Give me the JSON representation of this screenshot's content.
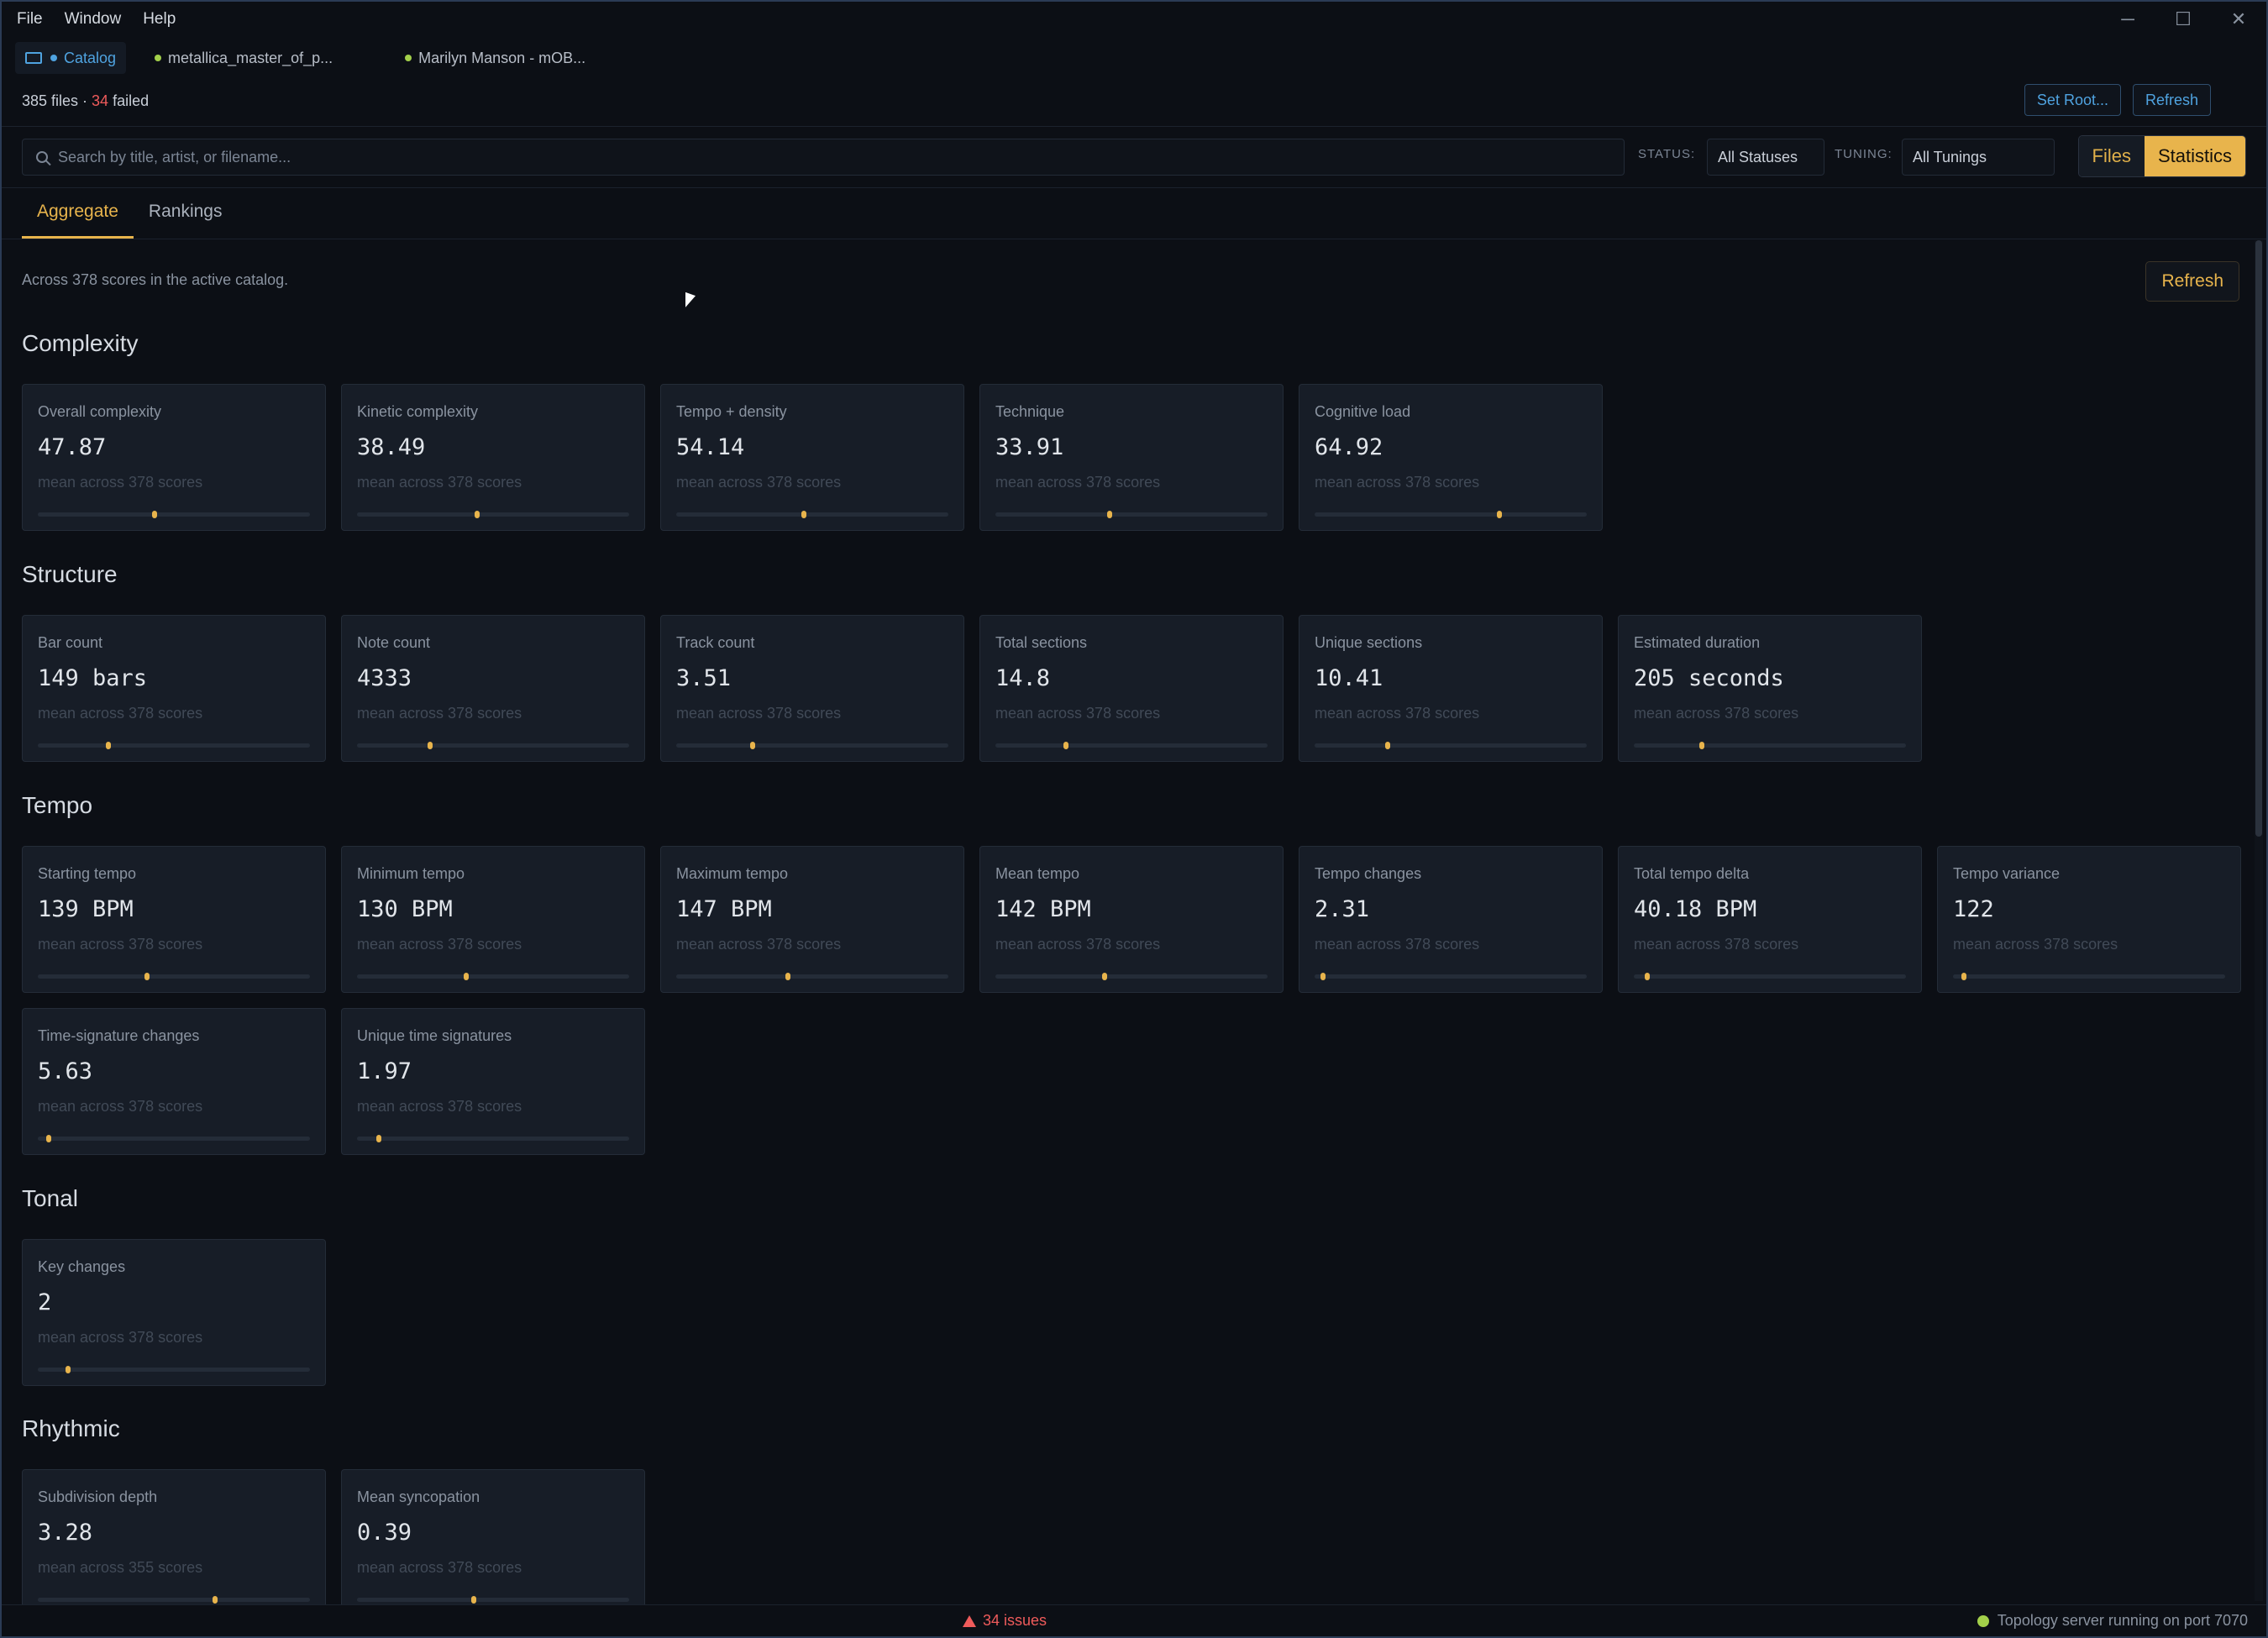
{
  "menu": [
    "File",
    "Window",
    "Help"
  ],
  "window_controls": {
    "minimize": "─",
    "maximize": "☐",
    "close": "✕"
  },
  "tabs": [
    {
      "label": "Catalog",
      "dot_color": "#4fa3e0"
    },
    {
      "label": "metallica_master_of_p...",
      "dot_color": "#a3d04a"
    },
    {
      "label": "Marilyn Manson - mOB...",
      "dot_color": "#a3d04a"
    }
  ],
  "counts": {
    "files": "385 files · ",
    "failed_n": "34",
    "failed_word": " failed"
  },
  "top_buttons": {
    "set_root": "Set Root...",
    "refresh": "Refresh"
  },
  "search": {
    "placeholder": "Search by title, artist, or filename..."
  },
  "filters": {
    "status_label": "STATUS:",
    "status_value": "All Statuses",
    "tuning_label": "TUNING:",
    "tuning_value": "All Tunings"
  },
  "view_toggle": {
    "files": "Files",
    "statistics": "Statistics",
    "active": "Statistics"
  },
  "subtabs": [
    {
      "label": "Aggregate",
      "active": true
    },
    {
      "label": "Rankings",
      "active": false
    }
  ],
  "summary": "Across 378 scores in the active catalog.",
  "refresh_label": "Refresh",
  "sections": [
    {
      "title": "Complexity",
      "cards": [
        {
          "label": "Overall complexity",
          "value": "47.87",
          "sub": "mean across 378 scores",
          "pos": 0.43
        },
        {
          "label": "Kinetic complexity",
          "value": "38.49",
          "sub": "mean across 378 scores",
          "pos": 0.44
        },
        {
          "label": "Tempo + density",
          "value": "54.14",
          "sub": "mean across 378 scores",
          "pos": 0.47
        },
        {
          "label": "Technique",
          "value": "33.91",
          "sub": "mean across 378 scores",
          "pos": 0.42
        },
        {
          "label": "Cognitive load",
          "value": "64.92",
          "sub": "mean across 378 scores",
          "pos": 0.68
        }
      ]
    },
    {
      "title": "Structure",
      "cards": [
        {
          "label": "Bar count",
          "value": "149 bars",
          "sub": "mean across 378 scores",
          "pos": 0.26
        },
        {
          "label": "Note count",
          "value": "4333",
          "sub": "mean across 378 scores",
          "pos": 0.27
        },
        {
          "label": "Track count",
          "value": "3.51",
          "sub": "mean across 378 scores",
          "pos": 0.28
        },
        {
          "label": "Total sections",
          "value": "14.8",
          "sub": "mean across 378 scores",
          "pos": 0.26
        },
        {
          "label": "Unique sections",
          "value": "10.41",
          "sub": "mean across 378 scores",
          "pos": 0.27
        },
        {
          "label": "Estimated duration",
          "value": "205 seconds",
          "sub": "mean across 378 scores",
          "pos": 0.25
        }
      ]
    },
    {
      "title": "Tempo",
      "cards": [
        {
          "label": "Starting tempo",
          "value": "139 BPM",
          "sub": "mean across 378 scores",
          "pos": 0.4
        },
        {
          "label": "Minimum tempo",
          "value": "130 BPM",
          "sub": "mean across 378 scores",
          "pos": 0.4
        },
        {
          "label": "Maximum tempo",
          "value": "147 BPM",
          "sub": "mean across 378 scores",
          "pos": 0.41
        },
        {
          "label": "Mean tempo",
          "value": "142 BPM",
          "sub": "mean across 378 scores",
          "pos": 0.4
        },
        {
          "label": "Tempo changes",
          "value": "2.31",
          "sub": "mean across 378 scores",
          "pos": 0.03
        },
        {
          "label": "Total tempo delta",
          "value": "40.18 BPM",
          "sub": "mean across 378 scores",
          "pos": 0.05
        },
        {
          "label": "Tempo variance",
          "value": "122",
          "sub": "mean across 378 scores",
          "pos": 0.04
        },
        {
          "label": "Time-signature changes",
          "value": "5.63",
          "sub": "mean across 378 scores",
          "pos": 0.04
        },
        {
          "label": "Unique time signatures",
          "value": "1.97",
          "sub": "mean across 378 scores",
          "pos": 0.08
        }
      ]
    },
    {
      "title": "Tonal",
      "cards": [
        {
          "label": "Key changes",
          "value": "2",
          "sub": "mean across 378 scores",
          "pos": 0.11
        }
      ]
    },
    {
      "title": "Rhythmic",
      "cards": [
        {
          "label": "Subdivision depth",
          "value": "3.28",
          "sub": "mean across 355 scores",
          "pos": 0.65
        },
        {
          "label": "Mean syncopation",
          "value": "0.39",
          "sub": "mean across 378 scores",
          "pos": 0.43
        }
      ]
    }
  ],
  "status": {
    "issues": "34 issues",
    "server": "Topology server running on port 7070",
    "server_color": "#a3d04a"
  }
}
